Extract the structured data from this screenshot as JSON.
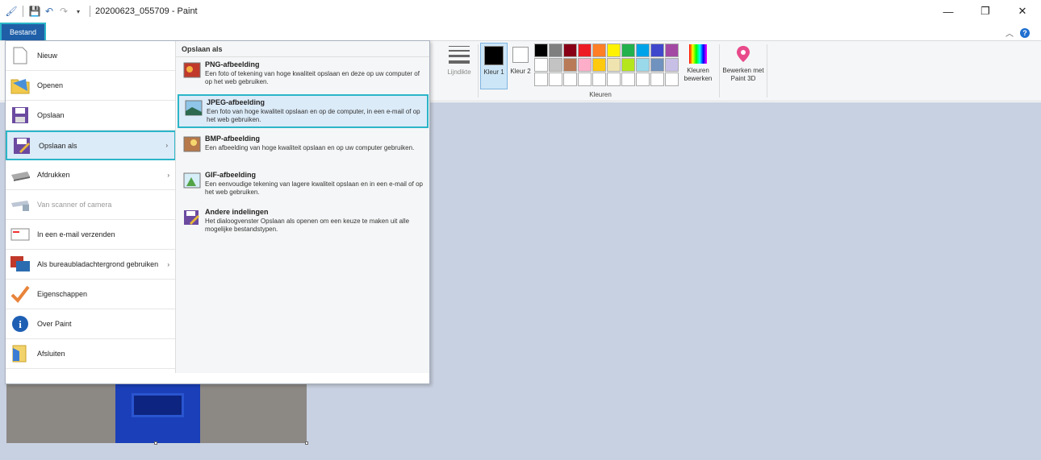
{
  "window": {
    "title": "20200623_055709 - Paint",
    "controls": [
      "—",
      "❐",
      "✕"
    ]
  },
  "ribbon": {
    "file_tab": "Bestand",
    "line_width_label": "Lijndikte",
    "color1_label": "Kleur 1",
    "color2_label": "Kleur 2",
    "colors_group_label": "Kleuren",
    "edit_colors_label": "Kleuren bewerken",
    "paint3d_label": "Bewerken met Paint 3D",
    "palette": [
      "#000000",
      "#7f7f7f",
      "#880015",
      "#ed1c24",
      "#ff7f27",
      "#fff200",
      "#22b14c",
      "#00a2e8",
      "#3f48cc",
      "#a349a4",
      "#ffffff",
      "#c3c3c3",
      "#b97a57",
      "#ffaec9",
      "#ffc90e",
      "#efe4b0",
      "#b5e61d",
      "#99d9ea",
      "#7092be",
      "#c8bfe7",
      "#ffffff",
      "#ffffff",
      "#ffffff",
      "#ffffff",
      "#ffffff",
      "#ffffff",
      "#ffffff",
      "#ffffff",
      "#ffffff",
      "#ffffff"
    ]
  },
  "file_menu": {
    "items": [
      {
        "label": "Nieuw",
        "icon": "new-file-icon"
      },
      {
        "label": "Openen",
        "icon": "open-folder-icon"
      },
      {
        "label": "Opslaan",
        "icon": "save-icon"
      },
      {
        "label": "Opslaan als",
        "icon": "save-as-icon"
      },
      {
        "label": "Afdrukken",
        "icon": "printer-icon"
      },
      {
        "label": "Van scanner of camera",
        "icon": "scanner-icon"
      },
      {
        "label": "In een e-mail verzenden",
        "icon": "email-icon"
      },
      {
        "label": "Als bureaubladachtergrond gebruiken",
        "icon": "desktop-icon"
      },
      {
        "label": "Eigenschappen",
        "icon": "checkmark-icon"
      },
      {
        "label": "Over Paint",
        "icon": "info-icon"
      },
      {
        "label": "Afsluiten",
        "icon": "exit-icon"
      }
    ],
    "submenu_title": "Opslaan als",
    "submenu": [
      {
        "title": "PNG-afbeelding",
        "desc": "Een foto of tekening van hoge kwaliteit opslaan en deze op uw computer of op het web gebruiken."
      },
      {
        "title": "JPEG-afbeelding",
        "desc": "Een foto van hoge kwaliteit opslaan en op de computer, in een e-mail of op het web gebruiken."
      },
      {
        "title": "BMP-afbeelding",
        "desc": "Een afbeelding van hoge kwaliteit opslaan en op uw computer gebruiken."
      },
      {
        "title": "GIF-afbeelding",
        "desc": "Een eenvoudige tekening van lagere kwaliteit opslaan en in een e-mail of op het web gebruiken."
      },
      {
        "title": "Andere indelingen",
        "desc": "Het dialoogvenster Opslaan als openen om een keuze te maken uit alle mogelijke bestandstypen."
      }
    ]
  }
}
